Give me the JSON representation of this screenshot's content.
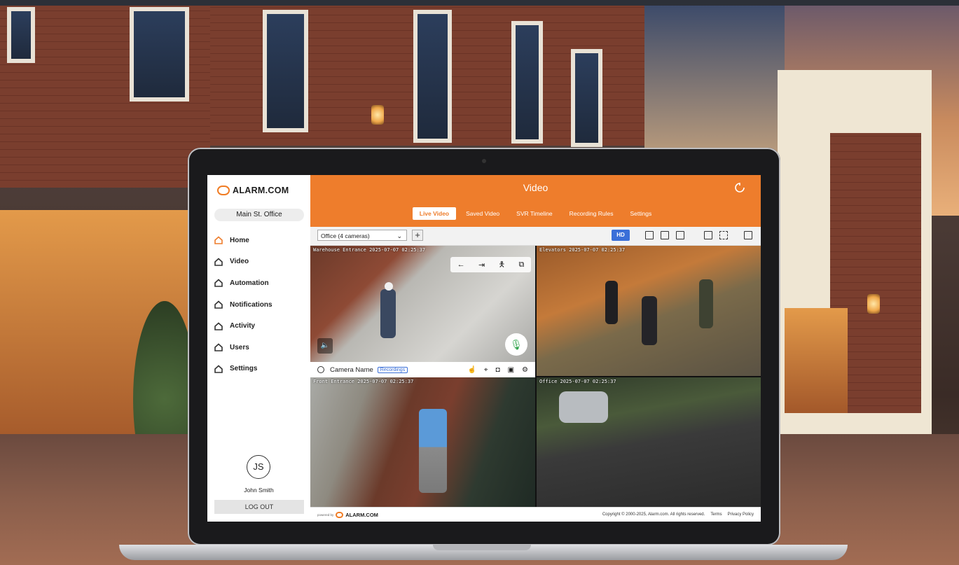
{
  "app": {
    "logo_text": "ALARM.COM",
    "site_name": "Main St. Office",
    "page_title": "Video"
  },
  "sidebar": {
    "items": [
      {
        "label": "Home",
        "icon": "home-icon",
        "active": true
      },
      {
        "label": "Video",
        "icon": "home-icon"
      },
      {
        "label": "Automation",
        "icon": "home-icon"
      },
      {
        "label": "Notifications",
        "icon": "home-icon"
      },
      {
        "label": "Activity",
        "icon": "home-icon"
      },
      {
        "label": "Users",
        "icon": "home-icon"
      },
      {
        "label": "Settings",
        "icon": "home-icon"
      }
    ],
    "user": {
      "initials": "JS",
      "name": "John Smith"
    },
    "logout_label": "LOG OUT"
  },
  "tabs": [
    {
      "label": "Live Video",
      "active": true
    },
    {
      "label": "Saved Video"
    },
    {
      "label": "SVR Timeline"
    },
    {
      "label": "Recording Rules"
    },
    {
      "label": "Settings"
    }
  ],
  "toolbar": {
    "camera_select": "Office (4 cameras)",
    "add_label": "+",
    "hd_label": "HD"
  },
  "feeds": [
    {
      "label": "Warehouse Entrance 2025-07-07 02:25:37"
    },
    {
      "label": "Elevators 2025-07-07 02:25:37"
    },
    {
      "label": "Front Entrance 2025-07-07 02:25:37"
    },
    {
      "label": "Office 2025-07-07 02:25:37"
    }
  ],
  "feed_bar": {
    "camera_name": "Camera Name",
    "recordings_label": "Recordings"
  },
  "footer": {
    "powered_by": "powered by",
    "logo_text": "ALARM.COM",
    "copyright": "Copyright © 2000-2025, Alarm.com. All rights reserved.",
    "terms": "Terms",
    "privacy": "Privacy Policy"
  },
  "colors": {
    "brand_orange": "#ee7d2c",
    "hd_blue": "#3a6fd8",
    "mic_green": "#2ea34a"
  }
}
